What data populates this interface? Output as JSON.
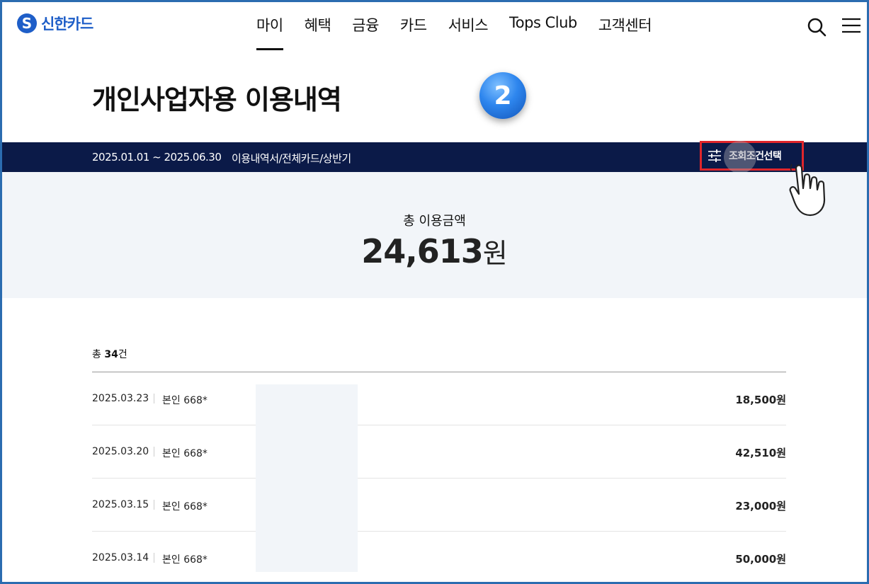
{
  "header": {
    "logo_text": "신한카드",
    "nav": [
      "마이",
      "혜택",
      "금융",
      "카드",
      "서비스",
      "Tops Club",
      "고객센터"
    ],
    "active_nav": "마이"
  },
  "page": {
    "title": "개인사업자용 이용내역",
    "step_number": "2"
  },
  "filter": {
    "period": "2025.01.01 ~ 2025.06.30",
    "description": "이용내역서/전체카드/상반기",
    "condition_button": "조회조건선택"
  },
  "summary": {
    "label": "총 이용금액",
    "amount": "24,613",
    "unit": "원"
  },
  "list": {
    "count_prefix": "총 ",
    "count": "34",
    "count_suffix": "건",
    "rows": [
      {
        "date": "2025.03.23",
        "card": "본인 668*",
        "amount": "18,500원"
      },
      {
        "date": "2025.03.20",
        "card": "본인 668*",
        "amount": "42,510원"
      },
      {
        "date": "2025.03.15",
        "card": "본인 668*",
        "amount": "23,000원"
      },
      {
        "date": "2025.03.14",
        "card": "본인 668*",
        "amount": "50,000원"
      }
    ]
  },
  "colors": {
    "brand": "#1e5ec8",
    "filter_bar": "#0b1a48",
    "highlight_box": "#e0262b",
    "summary_bg": "#f2f5f9"
  },
  "icons": {
    "logo": "shinhan-s-logo-icon",
    "search": "search-icon",
    "menu": "hamburger-menu-icon",
    "filter": "sliders-icon",
    "pointer": "hand-pointer-icon"
  }
}
